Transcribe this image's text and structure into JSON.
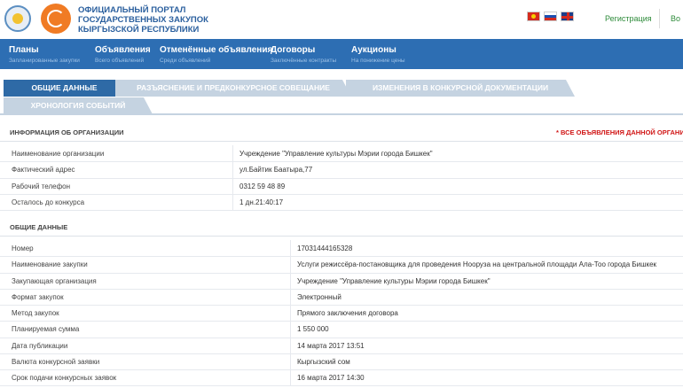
{
  "header": {
    "portal_title_line1": "ОФИЦИАЛЬНЫЙ ПОРТАЛ",
    "portal_title_line2": "ГОСУДАРСТВЕННЫХ ЗАКУПОК",
    "portal_title_line3": "КЫРГЫЗСКОЙ РЕСПУБЛИКИ",
    "register_link": "Регистрация",
    "login_link": "Во"
  },
  "nav": [
    {
      "title": "Планы",
      "subtitle": "Запланированные закупки"
    },
    {
      "title": "Объявления",
      "subtitle": "Всего объявлений"
    },
    {
      "title": "Отменённые объявления",
      "subtitle": "Среди объявлений"
    },
    {
      "title": "Договоры",
      "subtitle": "Заключённые контракты"
    },
    {
      "title": "Аукционы",
      "subtitle": "На понижение цены"
    }
  ],
  "tabs": [
    {
      "label": "ОБЩИЕ ДАННЫЕ"
    },
    {
      "label": "РАЗЪЯСНЕНИЕ И ПРЕДКОНКУРСНОЕ СОВЕЩАНИЕ"
    },
    {
      "label": "ИЗМЕНЕНИЯ В КОНКУРСНОЙ ДОКУМЕНТАЦИИ"
    },
    {
      "label": "ХРОНОЛОГИЯ СОБЫТИЙ"
    }
  ],
  "org_section": {
    "title": "ИНФОРМАЦИЯ ОБ ОРГАНИЗАЦИИ",
    "note": "* ВСЕ ОБЪЯВЛЕНИЯ ДАННОЙ ОРГАНИЗАЦИ",
    "rows": [
      {
        "label": "Наименование организации",
        "value": "Учреждение \"Управление культуры Мэрии города Бишкек\""
      },
      {
        "label": "Фактический адрес",
        "value": "ул.Байтик Баатыра,77"
      },
      {
        "label": "Рабочий телефон",
        "value": "0312 59 48 89"
      },
      {
        "label": "Осталось до конкурса",
        "value": "1 дн.21:40:17"
      }
    ]
  },
  "general_section": {
    "title": "ОБЩИЕ ДАННЫЕ",
    "rows": [
      {
        "label": "Номер",
        "value": "17031444165328"
      },
      {
        "label": "Наименование закупки",
        "value": "Услуги режиссёра-постановщика для проведения Нооруза на центральной площади Ала-Тоо города Бишкек"
      },
      {
        "label": "Закупающая организация",
        "value": "Учреждение \"Управление культуры Мэрии города Бишкек\""
      },
      {
        "label": "Формат закупок",
        "value": "Электронный"
      },
      {
        "label": "Метод закупок",
        "value": "Прямого заключения договора"
      },
      {
        "label": "Планируемая сумма",
        "value": "1 550 000"
      },
      {
        "label": "Дата публикации",
        "value": "14 марта 2017 13:51"
      },
      {
        "label": "Валюта конкурсной заявки",
        "value": "Кыргызский сом"
      },
      {
        "label": "Срок подачи конкурсных заявок",
        "value": "16 марта 2017 14:30"
      }
    ]
  }
}
